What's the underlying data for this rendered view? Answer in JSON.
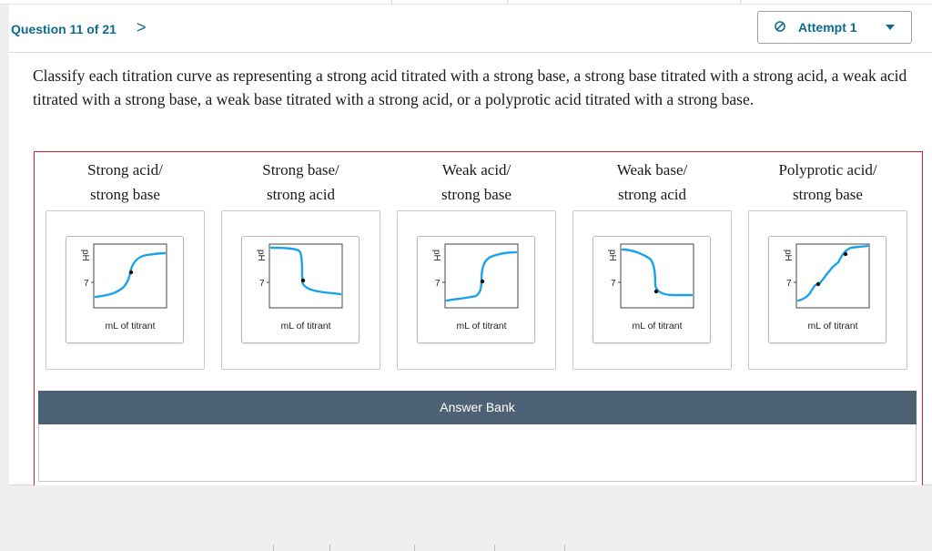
{
  "header": {
    "question_label": "Question 11 of 21",
    "next_glyph": ">",
    "attempt_label": "Attempt 1"
  },
  "instructions": "Classify each titration curve as representing a strong acid titrated with a strong base, a strong base titrated with a strong acid, a weak acid titrated with a strong base, a weak base titrated with a strong acid, or a polyprotic acid titrated with a strong base.",
  "categories": [
    {
      "line1": "Strong acid/",
      "line2": "strong base"
    },
    {
      "line1": "Strong base/",
      "line2": "strong acid"
    },
    {
      "line1": "Weak acid/",
      "line2": "strong base"
    },
    {
      "line1": "Weak base/",
      "line2": "strong acid"
    },
    {
      "line1": "Polyprotic acid/",
      "line2": "strong base"
    }
  ],
  "graph_labels": {
    "y_axis": "pH",
    "y_tick": "7",
    "x_axis": "mL of titrant"
  },
  "answer_bank_label": "Answer Bank",
  "colors": {
    "accent": "#0e6b8f",
    "curve": "#1aa3e8",
    "dropzone_border": "#d0202c",
    "answer_bank_header": "#4d6274"
  }
}
